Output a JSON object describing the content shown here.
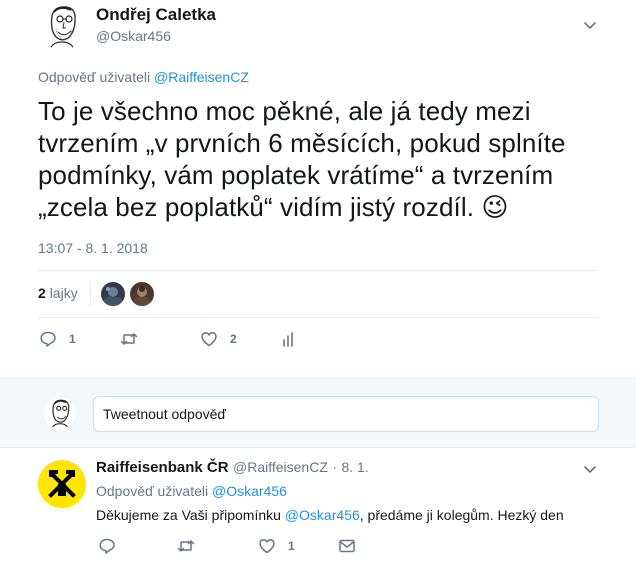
{
  "main_tweet": {
    "author_name": "Ondřej Caletka",
    "author_handle": "@Oskar456",
    "reply_to_prefix": "Odpověď uživateli",
    "reply_to_handle": "@RaiffeisenCZ",
    "text_lines": [
      "To je všechno moc pěkné, ale já tedy mezi",
      "tvrzením „v prvních 6 měsících, pokud splníte",
      "podmínky, vám poplatek vrátíme“ a tvrzením",
      "„zcela bez poplatků“ vidím jistý rozdíl."
    ],
    "emoji": "😉",
    "timestamp": "13:07 - 8. 1. 2018",
    "likes_count": "2",
    "likes_label": "lajky",
    "actions": {
      "reply_count": "1",
      "retweet_count": "",
      "like_count": "2"
    }
  },
  "reply_box": {
    "placeholder": "Tweetnout odpověď"
  },
  "reply_tweet": {
    "author_name": "Raiffeisenbank ČR",
    "author_handle": "@RaiffeisenCZ",
    "separator": "·",
    "date": "8. 1.",
    "reply_to_prefix": "Odpověď uživateli",
    "reply_to_handle": "@Oskar456",
    "text_before": "Děkujeme za Vaši připomínku ",
    "text_mention": "@Oskar456",
    "text_after": ", předáme ji kolegům. Hezký den",
    "actions": {
      "reply_count": "",
      "retweet_count": "",
      "like_count": "1"
    }
  },
  "colors": {
    "link": "#1b95e0",
    "muted": "#657786",
    "divider": "#e6ecf0",
    "raiffeisen_yellow": "#fee600"
  }
}
